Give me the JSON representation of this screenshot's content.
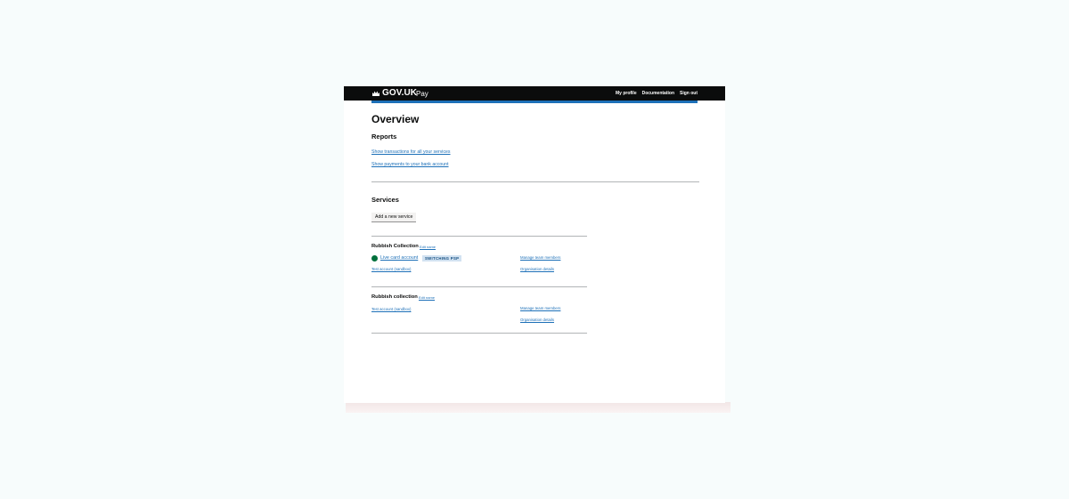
{
  "header": {
    "brand": "GOV.UK",
    "service": "Pay",
    "nav": [
      "My profile",
      "Documentation",
      "Sign out"
    ]
  },
  "page": {
    "title": "Overview"
  },
  "reports": {
    "heading": "Reports",
    "links": [
      "Show transactions for all your services",
      "Show payments to your bank account"
    ]
  },
  "services": {
    "heading": "Services",
    "add_button": "Add a new service",
    "items": [
      {
        "name": "Rubbish Collection",
        "edit": "Edit name",
        "live_link": "Live card account",
        "tag": "SWITCHING PSP",
        "test_link": "Test account (sandbox)",
        "manage_team": "Manage team members",
        "org_details": "Organisation details"
      },
      {
        "name": "Rubbish collection",
        "edit": "Edit name",
        "test_link": "Test account (sandbox)",
        "manage_team": "Manage team members",
        "org_details": "Organisation details"
      }
    ]
  },
  "colors": {
    "header_bg": "#0b0c0c",
    "accent_blue": "#1d70b8",
    "live_green": "#00703c",
    "tag_bg": "#d2e2f1"
  }
}
